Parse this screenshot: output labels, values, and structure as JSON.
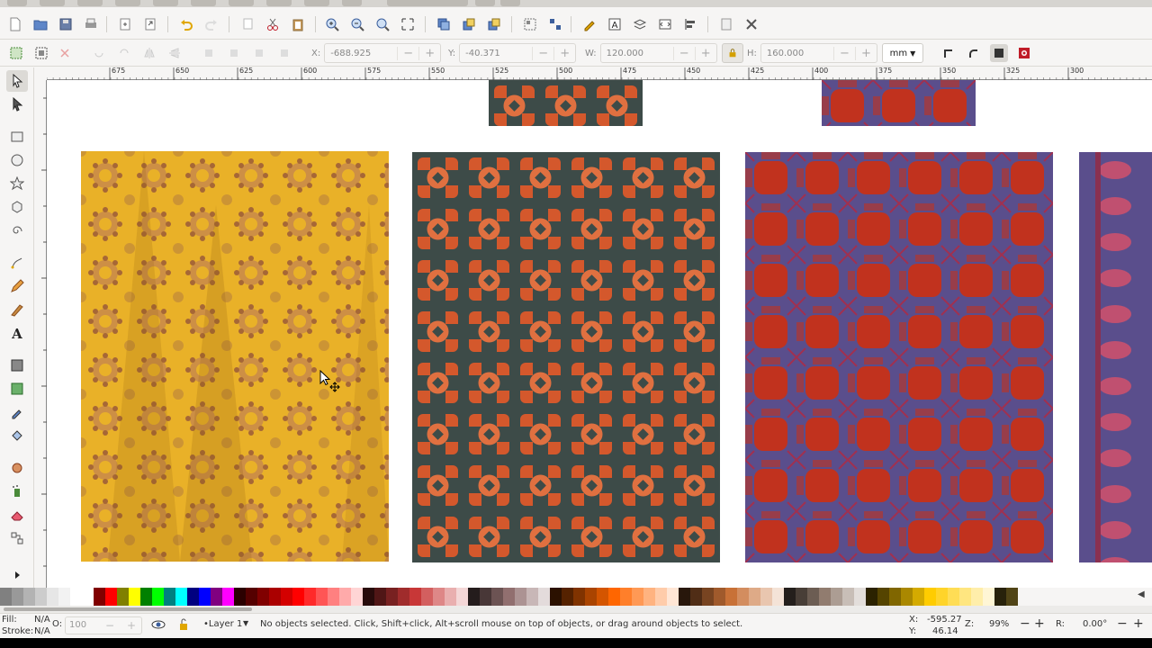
{
  "toolbar_controls": {
    "x_label": "X:",
    "x_value": "-688.925",
    "y_label": "Y:",
    "y_value": "-40.371",
    "w_label": "W:",
    "w_value": "120.000",
    "h_label": "H:",
    "h_value": "160.000",
    "unit": "mm",
    "step_minus": "−",
    "step_plus": "+"
  },
  "ruler": {
    "labels": [
      "675",
      "650",
      "625",
      "600",
      "575",
      "550",
      "525",
      "500",
      "475",
      "450",
      "425",
      "400",
      "375",
      "350",
      "325",
      "300"
    ]
  },
  "status": {
    "fill_label": "Fill:",
    "fill_value": "N/A",
    "stroke_label": "Stroke:",
    "stroke_value": "N/A",
    "opacity_label": "O:",
    "opacity_value": "100",
    "layer": "•Layer 1",
    "message": "No objects selected. Click, Shift+click, Alt+scroll mouse on top of objects, or drag around objects to select.",
    "coord_x_label": "X:",
    "coord_x": "-595.27",
    "coord_y_label": "Y:",
    "coord_y": "46.14",
    "zoom_label": "Z:",
    "zoom": "99%",
    "rotation_label": "R:",
    "rotation": "0.00°"
  },
  "colors": {
    "accent_red": "#c01c28",
    "yellow_tile": "#e9b128",
    "orange_tile": "#d4582c",
    "teal_dark": "#3d4b48",
    "purple_tile": "#5a4e8c",
    "red_tile": "#c1321e"
  },
  "palette": [
    "#808080",
    "#999999",
    "#b3b3b3",
    "#cccccc",
    "#e6e6e6",
    "#f2f2f2",
    "#ffffff",
    "#ffffff",
    "#800000",
    "#ff0000",
    "#808000",
    "#ffff00",
    "#008000",
    "#00ff00",
    "#008080",
    "#00ffff",
    "#000080",
    "#0000ff",
    "#800080",
    "#ff00ff",
    "#2b0000",
    "#550000",
    "#800000",
    "#aa0000",
    "#d40000",
    "#ff0000",
    "#ff2a2a",
    "#ff5555",
    "#ff8080",
    "#ffaaaa",
    "#ffd5d5",
    "#280b0b",
    "#501616",
    "#782121",
    "#a02c2c",
    "#c83737",
    "#d35f5f",
    "#de8787",
    "#e9afaf",
    "#f4d7d7",
    "#241c1c",
    "#483737",
    "#6c5353",
    "#916f6f",
    "#ac9393",
    "#c8b7b7",
    "#e3dbdb",
    "#2b1100",
    "#552200",
    "#803300",
    "#aa4400",
    "#d45500",
    "#ff6600",
    "#ff7f2a",
    "#ff9955",
    "#ffb380",
    "#ffccaa",
    "#ffe6d5",
    "#28170b",
    "#502d16",
    "#784421",
    "#a05a2c",
    "#c87137",
    "#d38d5f",
    "#deaa87",
    "#e9c6af",
    "#f4e3d7",
    "#241f1c",
    "#483e37",
    "#6c5d53",
    "#917c6f",
    "#ac9d93",
    "#c8beb7",
    "#e3dedb",
    "#2b2200",
    "#554400",
    "#806600",
    "#aa8800",
    "#d4aa00",
    "#ffcc00",
    "#ffd42a",
    "#ffdd55",
    "#ffe680",
    "#ffeeaa",
    "#fff6d5",
    "#28220b",
    "#504416"
  ]
}
